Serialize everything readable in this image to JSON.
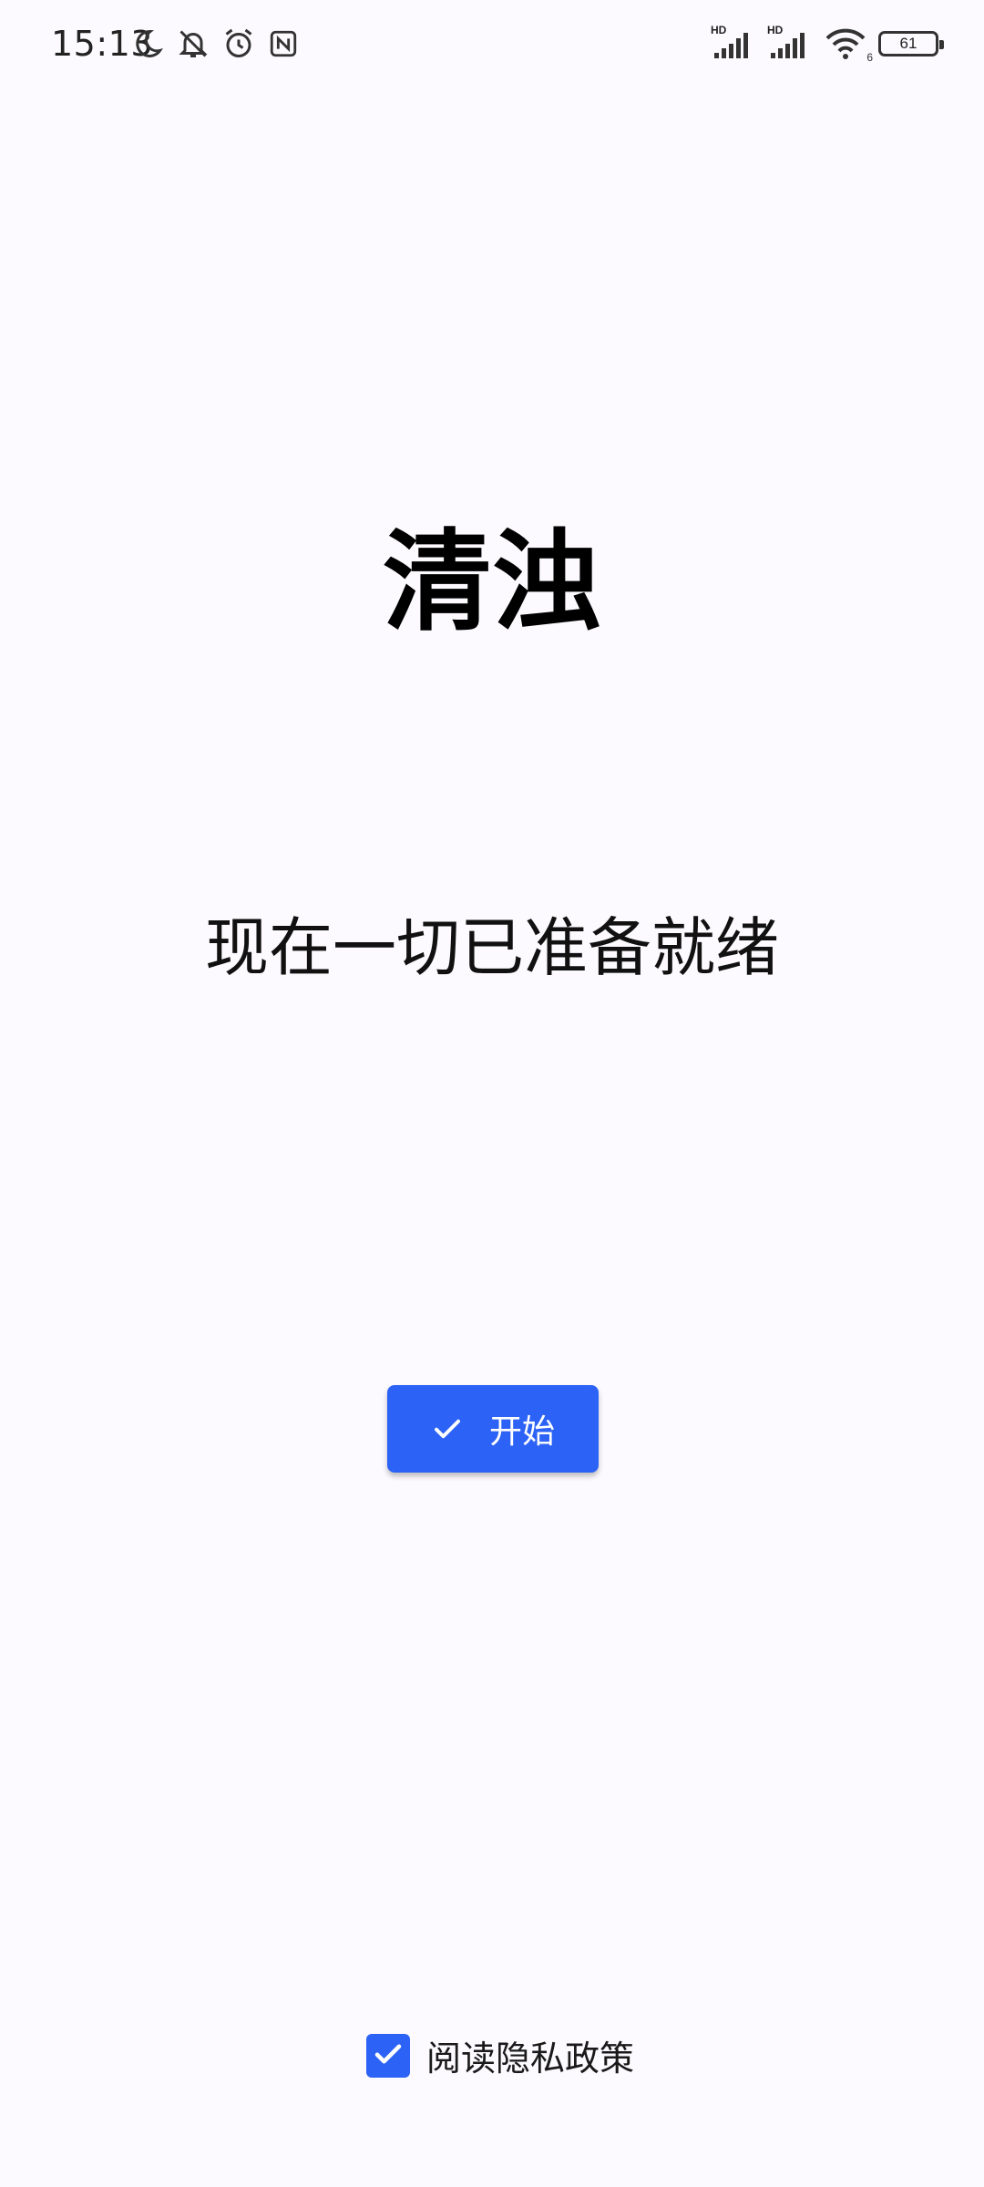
{
  "status_bar": {
    "time": "15:13",
    "left_icons": [
      "moon-icon",
      "bell-off-icon",
      "alarm-icon",
      "nfc-icon"
    ],
    "signal_1_label": "HD",
    "signal_2_label": "HD",
    "wifi_label": "6",
    "battery_level": "61"
  },
  "main": {
    "app_title": "清浊",
    "subtitle": "现在一切已准备就绪",
    "start_button_label": "开始"
  },
  "footer": {
    "privacy_checked": true,
    "privacy_label": "阅读隐私政策"
  },
  "colors": {
    "background": "#FCFAFE",
    "accent": "#2C62F5"
  }
}
